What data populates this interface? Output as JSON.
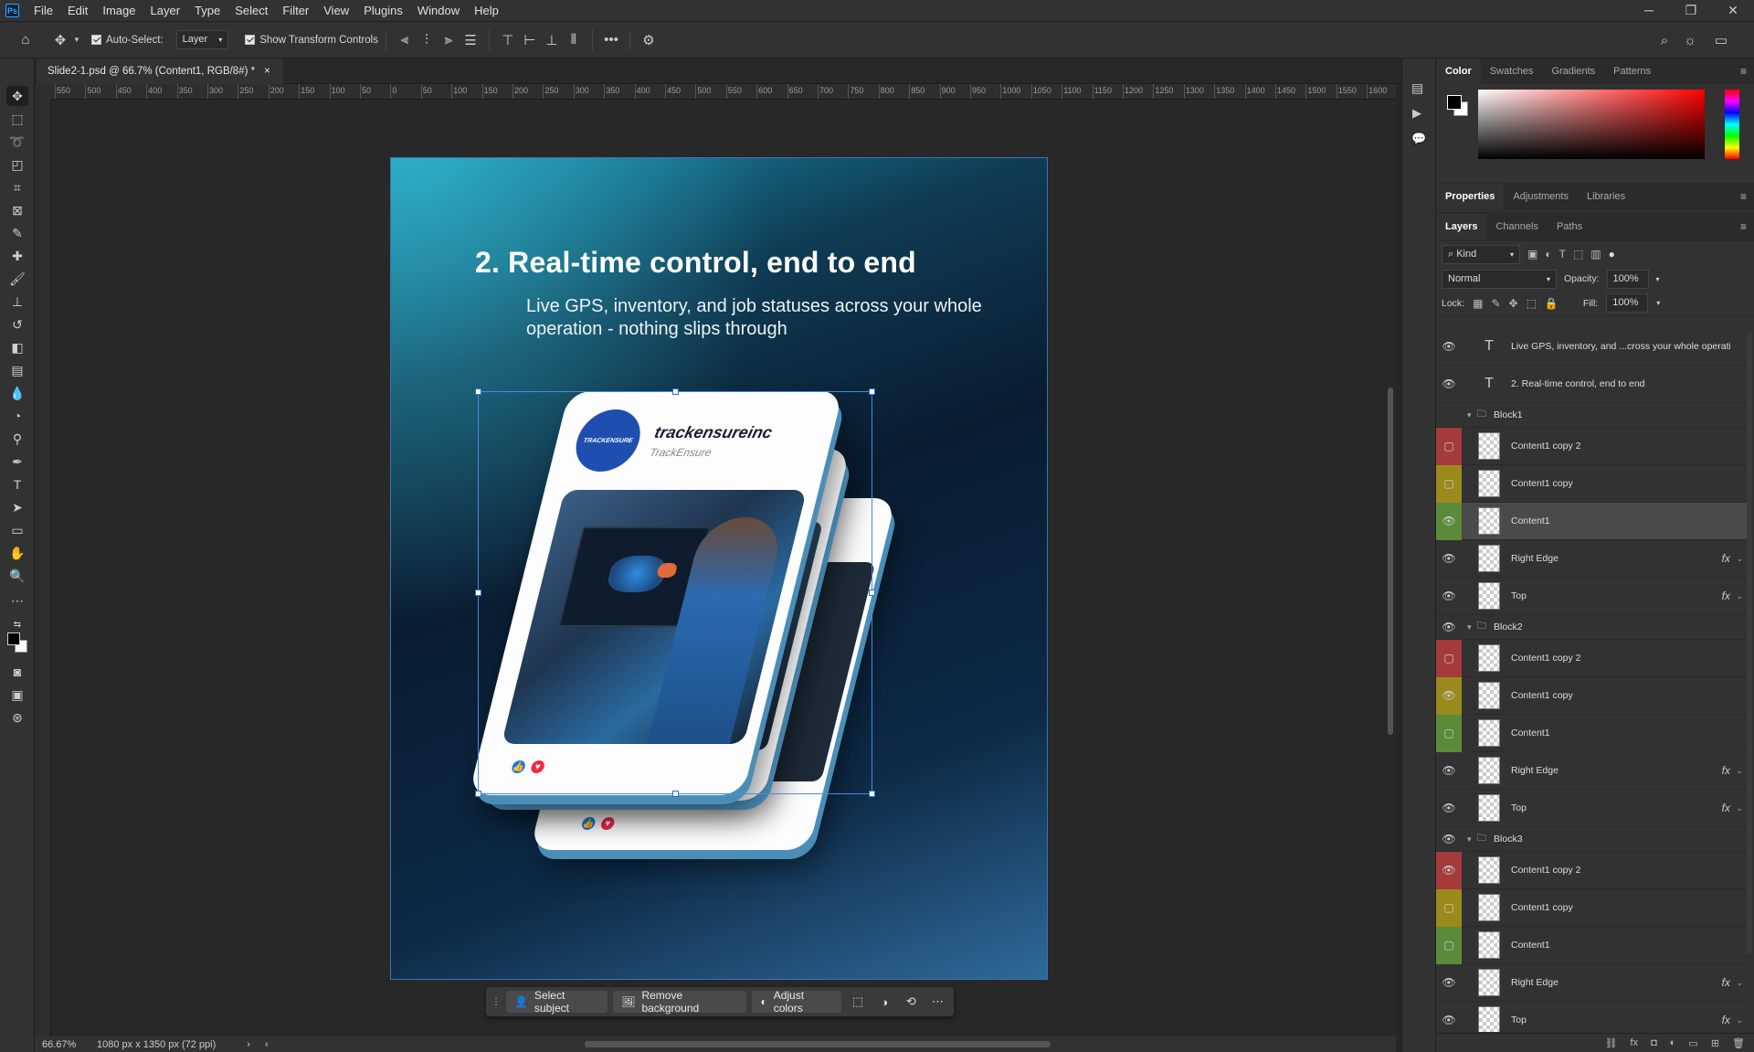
{
  "app": {
    "menu": [
      "File",
      "Edit",
      "Image",
      "Layer",
      "Type",
      "Select",
      "Filter",
      "View",
      "Plugins",
      "Window",
      "Help"
    ],
    "logo": "Ps"
  },
  "options_bar": {
    "auto_select_label": "Auto-Select:",
    "auto_select_value": "Layer",
    "show_transform_label": "Show Transform Controls",
    "more": "•••"
  },
  "document": {
    "tab_title": "Slide2-1.psd @ 66.7% (Content1, RGB/8#) *",
    "tab_close": "×",
    "ruler_labels": [
      "550",
      "500",
      "450",
      "400",
      "350",
      "300",
      "250",
      "200",
      "150",
      "100",
      "50",
      "0",
      "50",
      "100",
      "150",
      "200",
      "250",
      "300",
      "350",
      "400",
      "450",
      "500",
      "550",
      "600",
      "650",
      "700",
      "750",
      "800",
      "850",
      "900",
      "950",
      "1000",
      "1050",
      "1100",
      "1150",
      "1200",
      "1250",
      "1300",
      "1350",
      "1400",
      "1450",
      "1500",
      "1550",
      "1600"
    ],
    "zoom": "66.67%",
    "doc_size": "1080 px x 1350 px (72 ppi)"
  },
  "canvas": {
    "headline": "2. Real-time control, end to end",
    "subline": "Live GPS, inventory, and job statuses across your whole operation - nothing slips through",
    "card_username": "trackensureinc",
    "card_subname": "TrackEnsure",
    "logo_text": "TRACKENSURE"
  },
  "taskbar": {
    "select_subject": "Select subject",
    "remove_background": "Remove background",
    "adjust_colors": "Adjust colors"
  },
  "color_panel": {
    "tabs": [
      "Color",
      "Swatches",
      "Gradients",
      "Patterns"
    ],
    "active": "Color"
  },
  "properties_panel": {
    "tabs": [
      "Properties",
      "Adjustments",
      "Libraries"
    ]
  },
  "layers_panel": {
    "tabs": [
      "Layers",
      "Channels",
      "Paths"
    ],
    "kind_label": "Kind",
    "blend_mode": "Normal",
    "opacity_label": "Opacity:",
    "opacity_value": "100%",
    "lock_label": "Lock:",
    "fill_label": "Fill:",
    "fill_value": "100%",
    "layers": [
      {
        "name": "Live GPS, inventory, and ...cross your whole operati",
        "type": "text",
        "color": "",
        "visible": true
      },
      {
        "name": "2. Real-time control, end to end",
        "type": "text",
        "color": "",
        "visible": true
      },
      {
        "name": "Block1",
        "type": "group",
        "color": "",
        "visible": false
      },
      {
        "name": "Content1 copy 2",
        "type": "smart",
        "color": "red",
        "visible": false
      },
      {
        "name": "Content1 copy",
        "type": "smart",
        "color": "yellow",
        "visible": false
      },
      {
        "name": "Content1",
        "type": "smart",
        "color": "green",
        "visible": true,
        "selected": true
      },
      {
        "name": "Right Edge",
        "type": "smart",
        "color": "",
        "visible": true,
        "fx": true
      },
      {
        "name": "Top",
        "type": "smart",
        "color": "",
        "visible": true,
        "fx": true
      },
      {
        "name": "Block2",
        "type": "group",
        "color": "",
        "visible": true
      },
      {
        "name": "Content1 copy 2",
        "type": "smart",
        "color": "red",
        "visible": false
      },
      {
        "name": "Content1 copy",
        "type": "smart",
        "color": "yellow",
        "visible": true
      },
      {
        "name": "Content1",
        "type": "smart",
        "color": "green",
        "visible": false
      },
      {
        "name": "Right Edge",
        "type": "smart",
        "color": "",
        "visible": true,
        "fx": true
      },
      {
        "name": "Top",
        "type": "smart",
        "color": "",
        "visible": true,
        "fx": true
      },
      {
        "name": "Block3",
        "type": "group",
        "color": "",
        "visible": true
      },
      {
        "name": "Content1 copy 2",
        "type": "smart",
        "color": "red",
        "visible": true
      },
      {
        "name": "Content1 copy",
        "type": "smart",
        "color": "yellow",
        "visible": false
      },
      {
        "name": "Content1",
        "type": "smart",
        "color": "green",
        "visible": false
      },
      {
        "name": "Right Edge",
        "type": "smart",
        "color": "",
        "visible": true,
        "fx": true
      },
      {
        "name": "Top",
        "type": "smart",
        "color": "",
        "visible": true,
        "fx": true
      }
    ],
    "fx_label": "fx"
  }
}
